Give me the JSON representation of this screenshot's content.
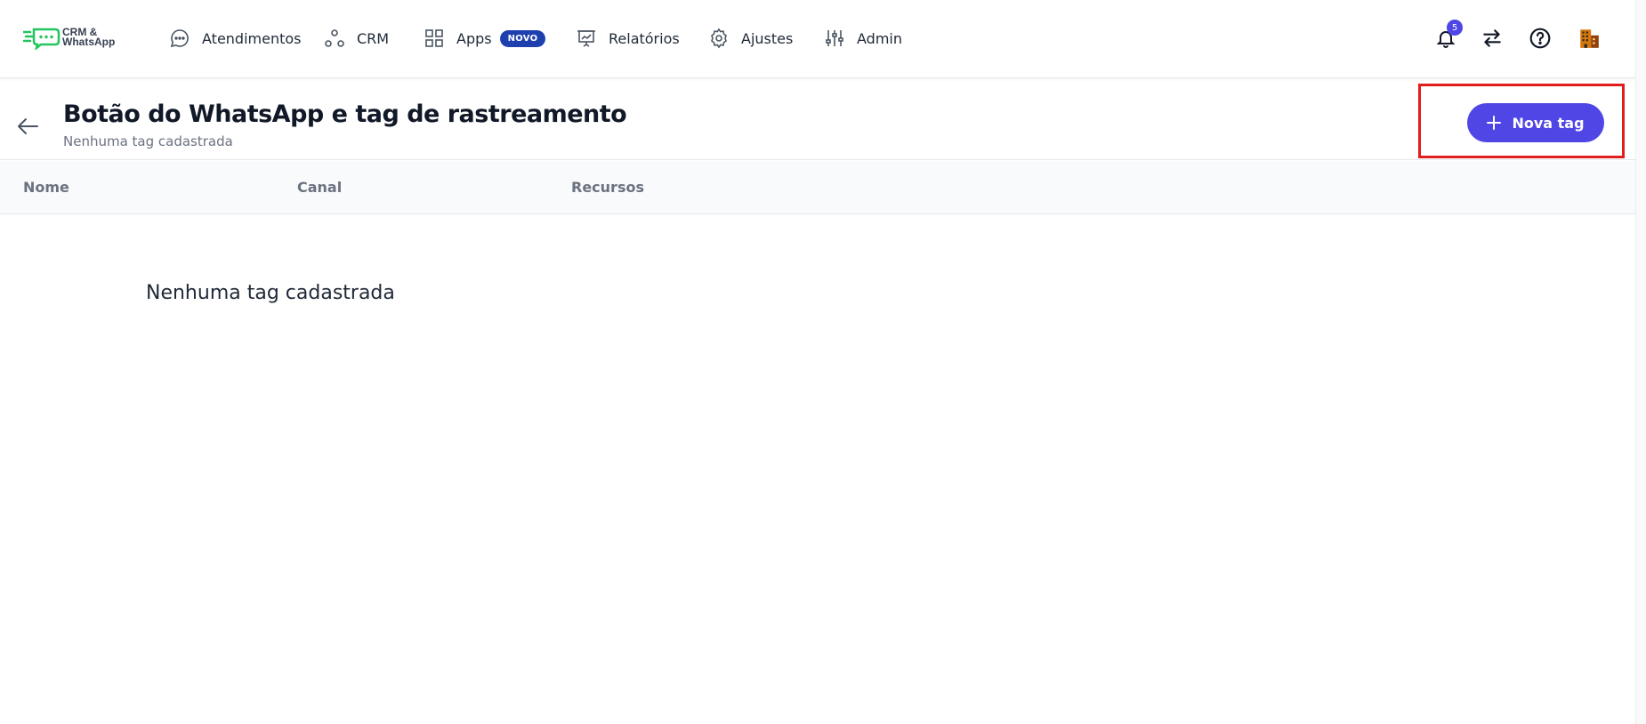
{
  "app": {
    "logo_line1": "CRM &",
    "logo_line2": "WhatsApp"
  },
  "nav": {
    "items": [
      {
        "label": "Atendimentos",
        "icon": "chat-bubble-icon"
      },
      {
        "label": "CRM",
        "icon": "crm-nodes-icon"
      },
      {
        "label": "Apps",
        "icon": "grid-icon",
        "badge": "NOVO"
      },
      {
        "label": "Relatórios",
        "icon": "presentation-chart-icon"
      },
      {
        "label": "Ajustes",
        "icon": "gear-icon"
      },
      {
        "label": "Admin",
        "icon": "sliders-icon"
      }
    ]
  },
  "top_right": {
    "notification_count": "5"
  },
  "header": {
    "title": "Botão do WhatsApp e tag de rastreamento",
    "subtitle": "Nenhuma tag cadastrada",
    "new_button": "Nova tag"
  },
  "table": {
    "columns": [
      "Nome",
      "Canal",
      "Recursos"
    ],
    "empty_message": "Nenhuma tag cadastrada"
  },
  "colors": {
    "primary": "#4f46e5",
    "badge": "#1e40af",
    "highlight": "#e11d1d",
    "logo_green": "#22c55e"
  }
}
